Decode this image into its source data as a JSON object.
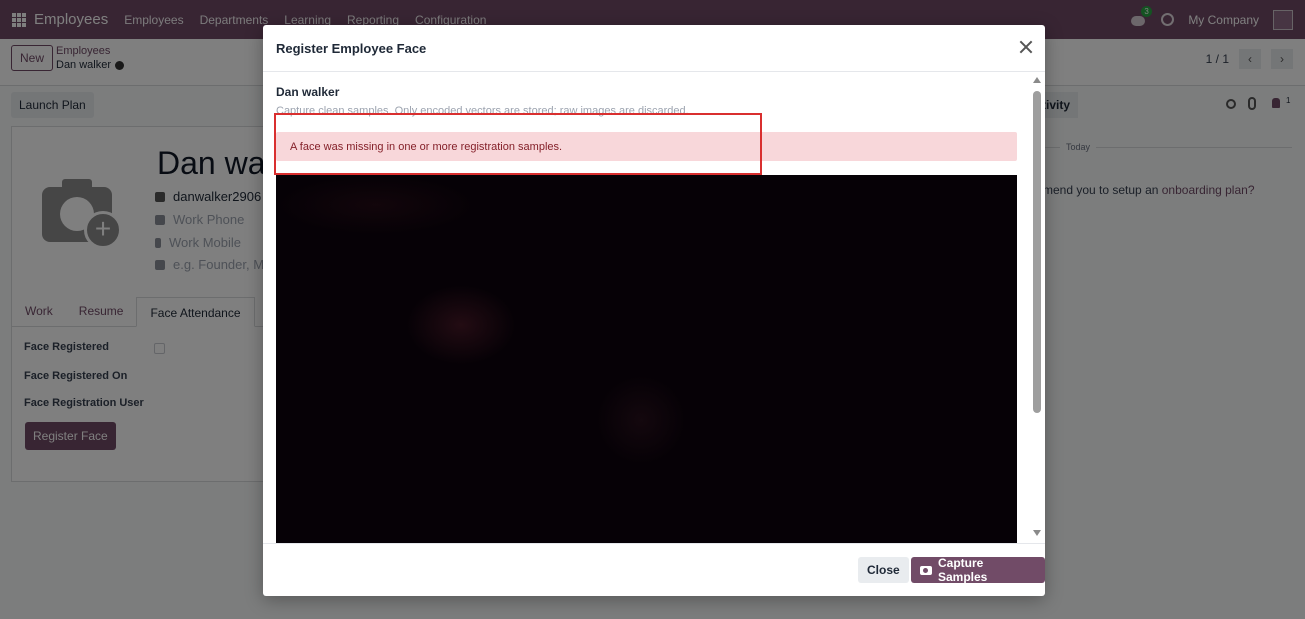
{
  "topbar": {
    "brand": "Employees",
    "nav": [
      "Employees",
      "Departments",
      "Learning",
      "Reporting",
      "Configuration"
    ],
    "chat_badge": "3",
    "company": "My Company"
  },
  "control": {
    "new_label": "New",
    "breadcrumb_parent": "Employees",
    "breadcrumb_current": "Dan walker",
    "pager": "1 / 1"
  },
  "form": {
    "launch_plan": "Launch Plan",
    "name": "Dan walker",
    "email": "danwalker2906",
    "work_phone_placeholder": "Work Phone",
    "work_mobile_placeholder": "Work Mobile",
    "tags_placeholder": "e.g. Founder, Mo",
    "tabs": [
      "Work",
      "Resume",
      "Face Attendance"
    ],
    "face_registered_label": "Face Registered",
    "face_registered_on_label": "Face Registered On",
    "face_registration_user_label": "Face Registration User",
    "register_face": "Register Face"
  },
  "chatter": {
    "activity": "tivity",
    "follower_count": "1",
    "today": "Today",
    "onboarding_text": "mend you to setup an ",
    "onboarding_link": "onboarding plan?"
  },
  "modal": {
    "title": "Register Employee Face",
    "employee": "Dan walker",
    "hint": "Capture clean samples. Only encoded vectors are stored; raw images are discarded.",
    "alert": "A face was missing in one or more registration samples.",
    "close_button": "Close",
    "capture_button": "Capture Samples"
  }
}
